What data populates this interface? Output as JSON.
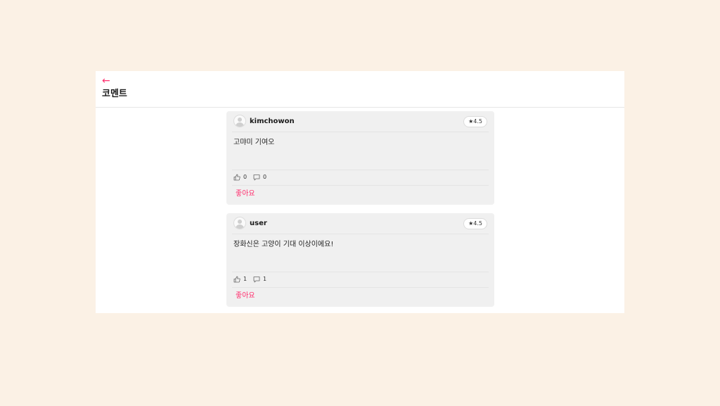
{
  "header": {
    "back_arrow": "←",
    "title": "코멘트"
  },
  "comments": [
    {
      "username": "kimchowon",
      "rating": "★4.5",
      "text": "고먀미 기여오",
      "likes": "0",
      "replies": "0",
      "like_label": "좋아요"
    },
    {
      "username": "user",
      "rating": "★4.5",
      "text": "장화신은 고양이 기대 이상이에요!",
      "likes": "1",
      "replies": "1",
      "like_label": "좋아요"
    }
  ],
  "colors": {
    "page_background": "#fbf1e5",
    "accent": "#ff2f6e",
    "card_background": "#f0f0f0"
  }
}
